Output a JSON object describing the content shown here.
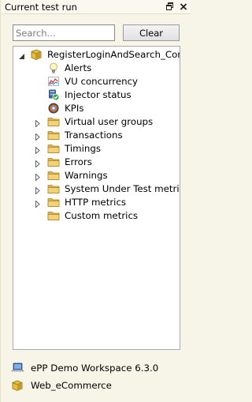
{
  "window": {
    "title": "Current test run"
  },
  "search": {
    "placeholder": "Search...",
    "value": ""
  },
  "clear_label": "Clear",
  "tree": {
    "root": {
      "label": "RegisterLoginAndSearch_Comb",
      "expanded": true
    },
    "leaf_items": [
      {
        "label": "Alerts",
        "icon": "bulb-icon"
      },
      {
        "label": "VU concurrency",
        "icon": "line-chart-icon"
      },
      {
        "label": "Injector status",
        "icon": "shield-check-icon"
      },
      {
        "label": "KPIs",
        "icon": "target-icon"
      }
    ],
    "groups": [
      {
        "label": "Virtual user groups",
        "icon": "folder-icon"
      },
      {
        "label": "Transactions",
        "icon": "folder-icon"
      },
      {
        "label": "Timings",
        "icon": "folder-icon"
      },
      {
        "label": "Errors",
        "icon": "folder-icon"
      },
      {
        "label": "Warnings",
        "icon": "folder-icon"
      },
      {
        "label": "System Under Test metrics",
        "icon": "folder-icon"
      },
      {
        "label": "HTTP metrics",
        "icon": "folder-icon"
      }
    ],
    "last_item": {
      "label": "Custom metrics",
      "icon": "folder-icon"
    }
  },
  "footer": {
    "workspace": {
      "label": "ePP Demo Workspace 6.3.0",
      "icon": "laptop-icon"
    },
    "project": {
      "label": "Web_eCommerce",
      "icon": "package-icon"
    }
  },
  "colors": {
    "panel_bg": "#f7f4e8",
    "folder": "#e8c15a",
    "tree_bg": "#ffffff"
  }
}
